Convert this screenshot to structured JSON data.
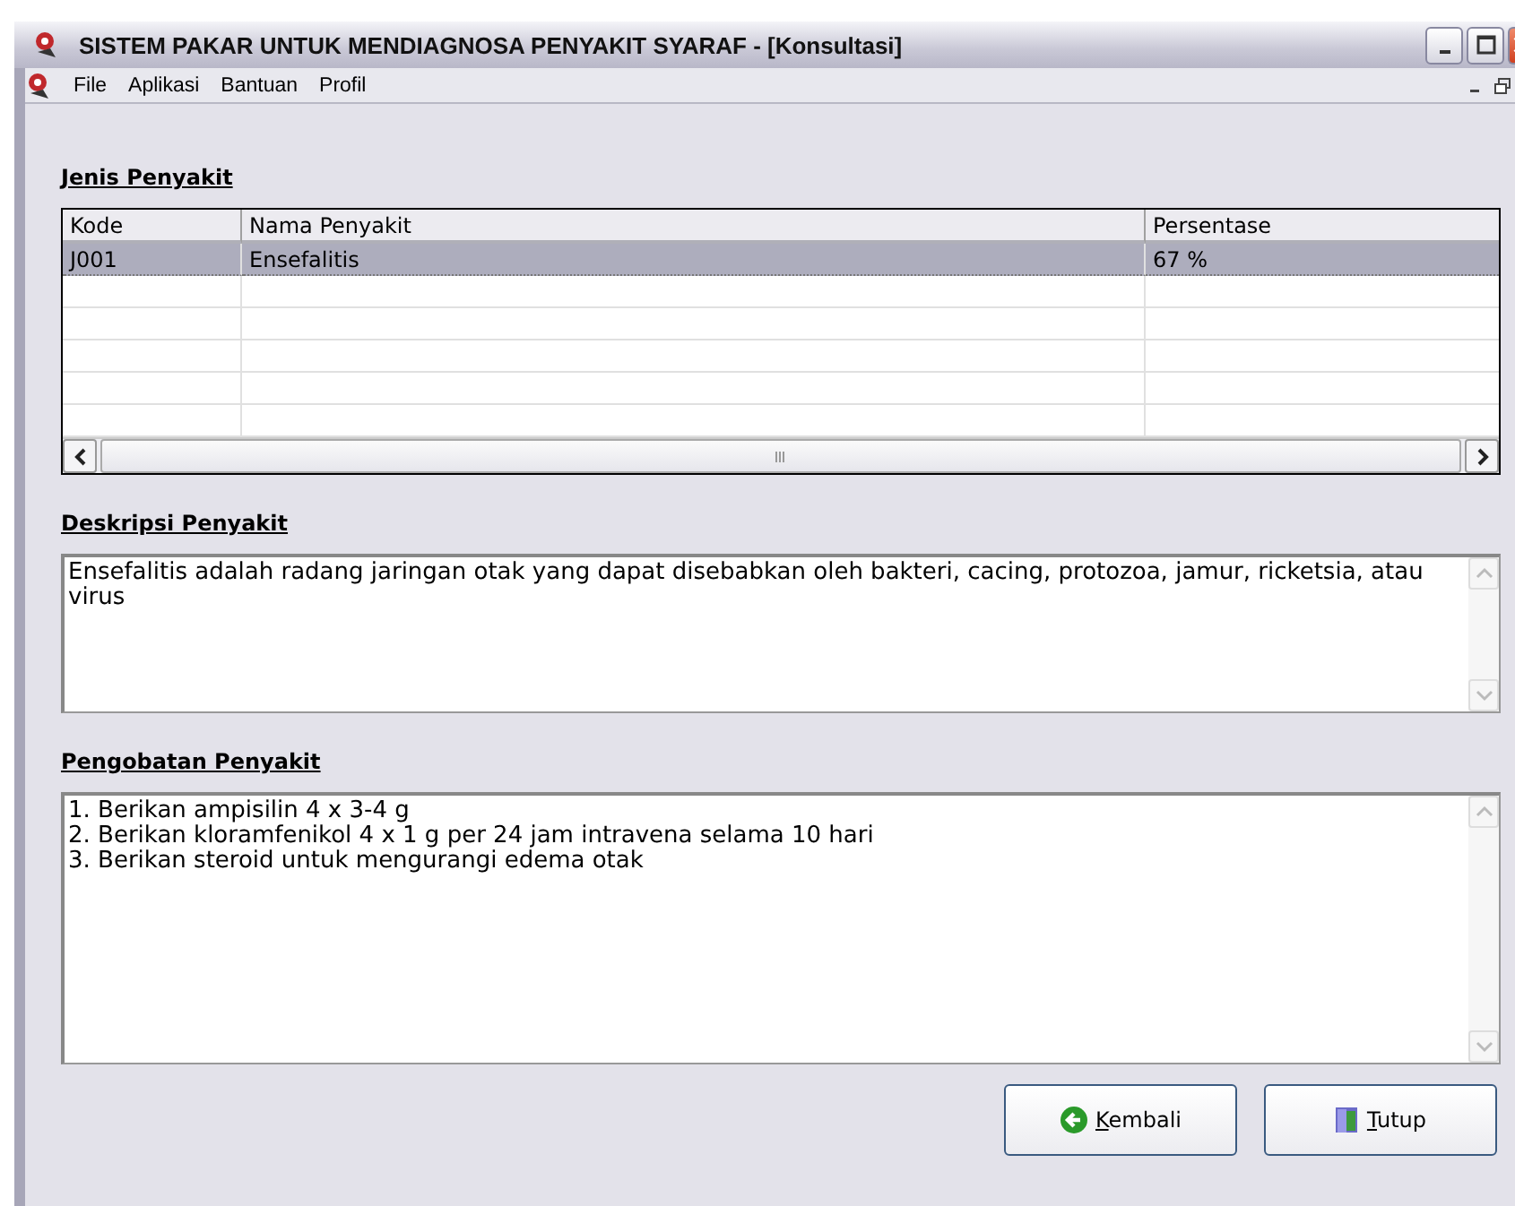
{
  "window": {
    "title": "SISTEM PAKAR UNTUK MENDIAGNOSA PENYAKIT SYARAF - [Konsultasi]"
  },
  "menu": [
    "File",
    "Aplikasi",
    "Bantuan",
    "Profil"
  ],
  "disease_section": {
    "heading": "Jenis Penyakit",
    "columns": [
      "Kode",
      "Nama Penyakit",
      "Persentase"
    ],
    "rows": [
      {
        "cells": [
          "J001",
          "Ensefalitis",
          "67 %"
        ],
        "selected": true
      }
    ]
  },
  "description_section": {
    "heading": "Deskripsi Penyakit",
    "text": "Ensefalitis adalah radang jaringan otak yang dapat disebabkan oleh bakteri, cacing, protozoa, jamur, ricketsia, atau virus"
  },
  "treatment_section": {
    "heading": "Pengobatan Penyakit",
    "lines": [
      "1. Berikan ampisilin 4 x 3-4 g",
      "2. Berikan kloramfenikol 4 x 1 g per 24 jam intravena selama 10 hari",
      "3. Berikan steroid untuk mengurangi edema otak"
    ]
  },
  "buttons": [
    {
      "kind": "back",
      "label": "Kembali"
    },
    {
      "kind": "close",
      "label": "Tutup"
    }
  ]
}
